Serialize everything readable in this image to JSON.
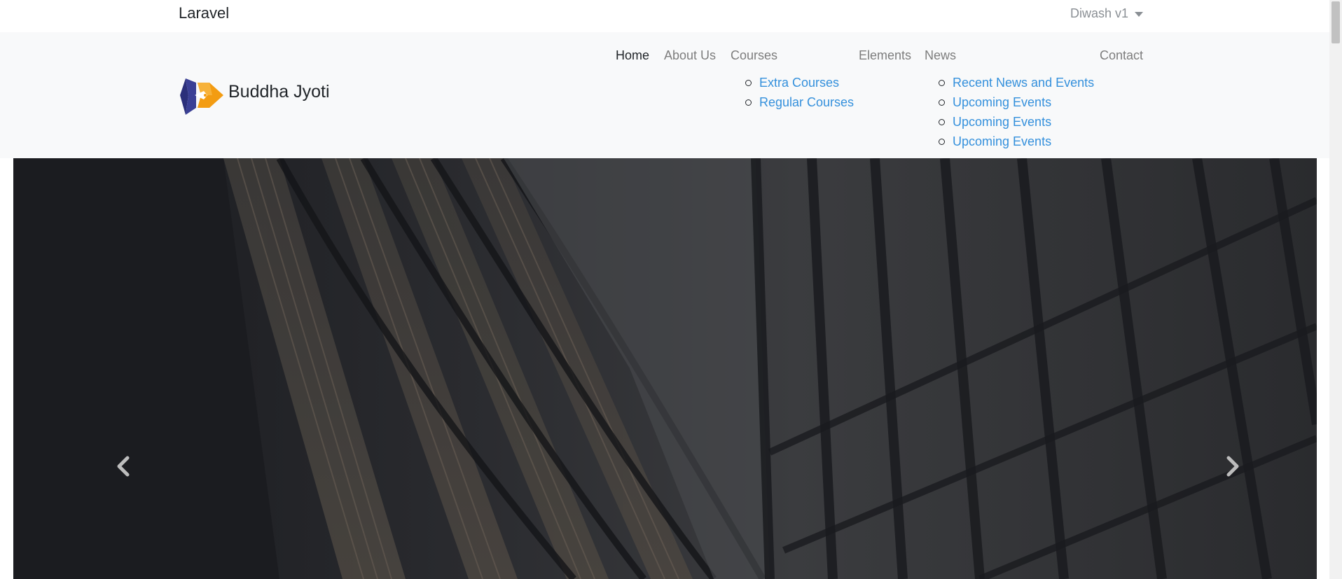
{
  "topbar": {
    "brand": "Laravel",
    "user_menu": "Diwash v1"
  },
  "navbar": {
    "brand_name": "Buddha Jyoti",
    "items": [
      {
        "label": "Home",
        "active": true
      },
      {
        "label": "About Us"
      },
      {
        "label": "Courses"
      },
      {
        "label": "Elements"
      },
      {
        "label": "News"
      },
      {
        "label": "Contact"
      }
    ],
    "courses_submenu": [
      "Extra Courses",
      "Regular Courses"
    ],
    "news_submenu": [
      "Recent News and Events",
      "Upcoming Events",
      "Upcoming Events",
      "Upcoming Events"
    ]
  },
  "carousel": {
    "prev_icon": "chevron-left-icon",
    "next_icon": "chevron-right-icon"
  },
  "colors": {
    "link": "#3490dc",
    "nav_bg": "#f8f9fa",
    "logo_navy": "#2b2f7a",
    "logo_orange": "#f39c12"
  }
}
